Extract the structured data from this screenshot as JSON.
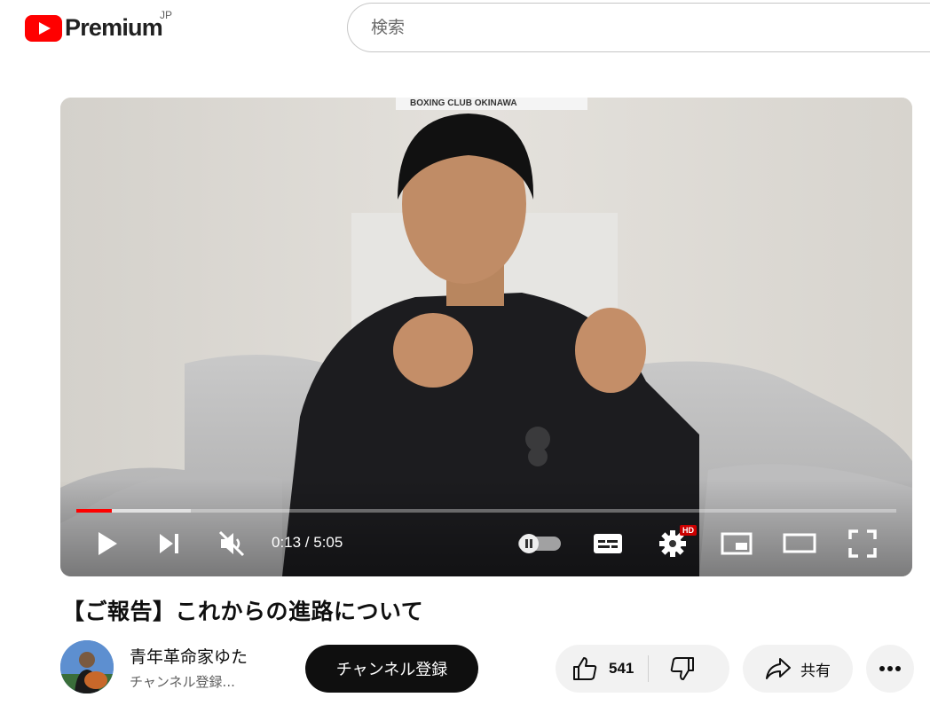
{
  "header": {
    "logo_text": "Premium",
    "region": "JP",
    "search_placeholder": "検索"
  },
  "video": {
    "poster_sign_text": "BOXING CLUB OKINAWA",
    "current_time": "0:13",
    "duration": "5:05",
    "time_display": "0:13 / 5:05",
    "progress_fraction": 0.043,
    "loaded_fraction": 0.14,
    "muted": true,
    "quality_badge": "HD",
    "captions_toggle": "off"
  },
  "title": "【ご報告】これからの進路について",
  "owner": {
    "channel_name": "青年革命家ゆた",
    "subscriber_text": "チャンネル登録...",
    "subscribe_label": "チャンネル登録"
  },
  "actions": {
    "like_count": "541",
    "share_label": "共有"
  },
  "colors": {
    "brand_red": "#ff0000",
    "subscribe_bg": "#0f0f0f",
    "pill_bg": "#f2f2f2"
  }
}
